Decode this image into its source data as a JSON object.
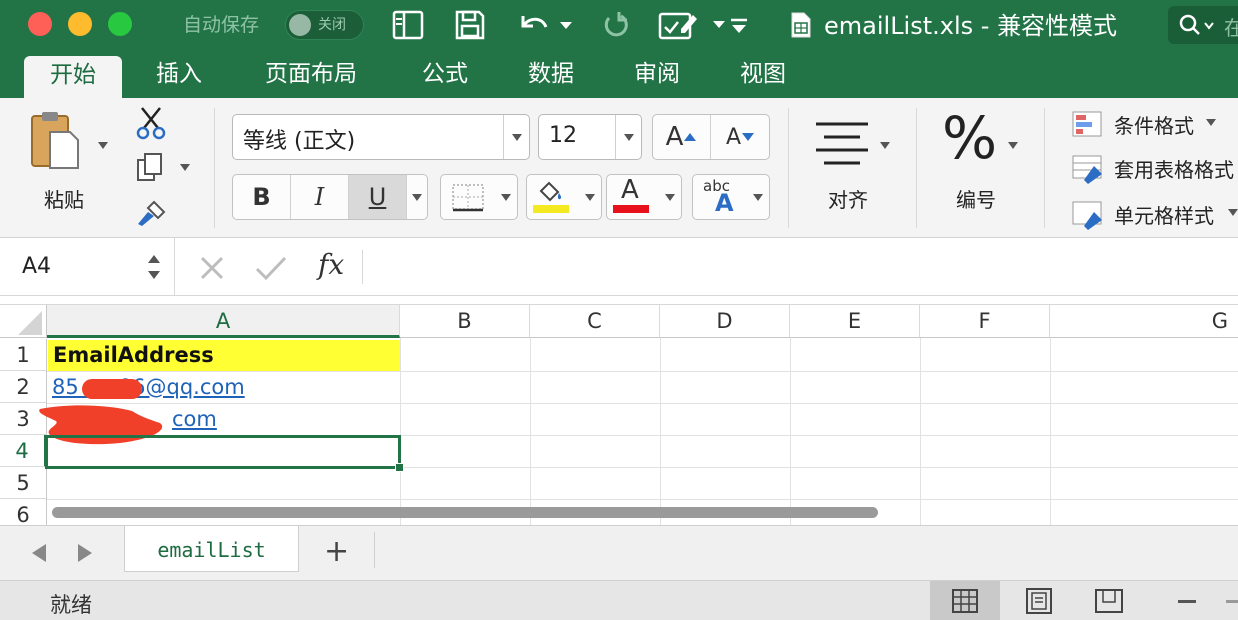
{
  "titlebar": {
    "autosave_label": "自动保存",
    "autosave_state": "关闭",
    "document_title": "emailList.xls  -  兼容性模式",
    "search_hint": "在"
  },
  "tabs": [
    "开始",
    "插入",
    "页面布局",
    "公式",
    "数据",
    "审阅",
    "视图"
  ],
  "active_tab": "开始",
  "ribbon": {
    "paste_label": "粘贴",
    "font_name": "等线 (正文)",
    "font_size": "12",
    "grow_font": "A",
    "shrink_font": "A",
    "bold": "B",
    "italic": "I",
    "underline": "U",
    "fill_color": "#f5ea22",
    "font_color_swatch": "#e8101a",
    "font_color_letter": "A",
    "text_effect_small": "abc",
    "text_effect_big": "A",
    "align_label": "对齐",
    "number_symbol": "%",
    "number_label": "编号",
    "styles": [
      "条件格式",
      "套用表格格式",
      "单元格样式"
    ]
  },
  "formula_bar": {
    "name_box": "A4",
    "fx": "fx",
    "content": ""
  },
  "grid": {
    "columns": [
      "A",
      "B",
      "C",
      "D",
      "E",
      "F",
      "G"
    ],
    "rows": [
      "1",
      "2",
      "3",
      "4",
      "5",
      "6"
    ],
    "selected_cell": "A4",
    "cells": {
      "A1": "EmailAddress",
      "A2": "85      06@qq.com",
      "A3": "com"
    },
    "header_fill": "#ffff33",
    "link_color": "#1f63b9",
    "redaction_color": "#f0402a"
  },
  "sheets": [
    "emailList"
  ],
  "add_sheet": "+",
  "status": "就绪",
  "accent": "#227447"
}
